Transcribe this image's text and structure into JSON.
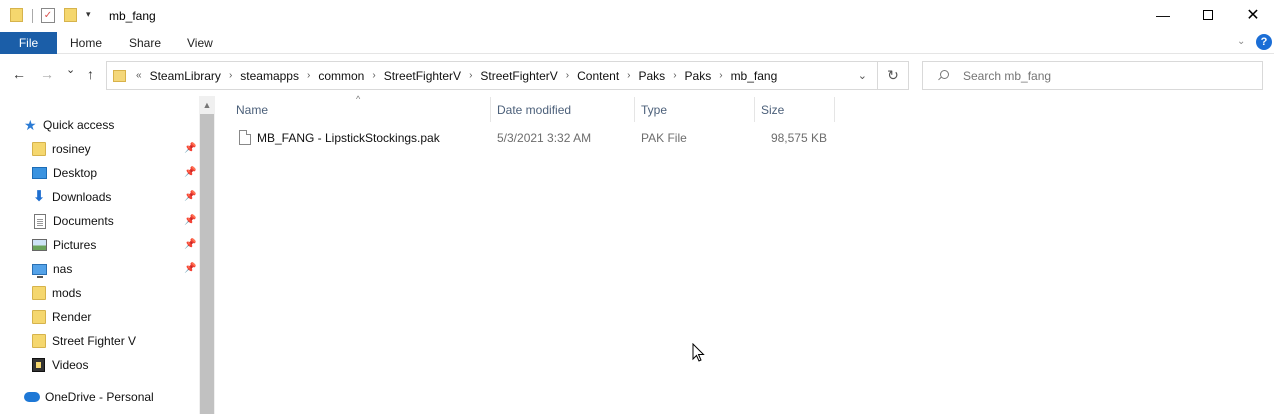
{
  "window": {
    "title": "mb_fang",
    "minimize_icon": "minimize-icon",
    "maximize_icon": "maximize-icon",
    "close_icon": "close-icon"
  },
  "ribbon": {
    "tabs": [
      {
        "label": "File",
        "active": true
      },
      {
        "label": "Home"
      },
      {
        "label": "Share"
      },
      {
        "label": "View"
      }
    ],
    "help_label": "?",
    "accent_color": "#1b5ea8"
  },
  "nav": {
    "back_glyph": "←",
    "forward_glyph": "→",
    "recent_glyph": "⌄",
    "up_glyph": "↑",
    "overflow": "«",
    "breadcrumbs": [
      "SteamLibrary",
      "steamapps",
      "common",
      "StreetFighterV",
      "StreetFighterV",
      "Content",
      "Paks",
      "Paks",
      "mb_fang"
    ],
    "refresh_glyph": "↻",
    "search_placeholder": "Search mb_fang"
  },
  "sidebar": {
    "quick_access": "Quick access",
    "items": [
      {
        "label": "rosiney",
        "icon": "folder-icon",
        "pinned": true
      },
      {
        "label": "Desktop",
        "icon": "desktop-icon",
        "pinned": true
      },
      {
        "label": "Downloads",
        "icon": "downloads-icon",
        "pinned": true
      },
      {
        "label": "Documents",
        "icon": "documents-icon",
        "pinned": true
      },
      {
        "label": "Pictures",
        "icon": "pictures-icon",
        "pinned": true
      },
      {
        "label": "nas",
        "icon": "network-drive-icon",
        "pinned": true
      },
      {
        "label": "mods",
        "icon": "folder-icon",
        "pinned": false
      },
      {
        "label": "Render",
        "icon": "folder-icon",
        "pinned": false
      },
      {
        "label": "Street Fighter V",
        "icon": "folder-icon",
        "pinned": false
      },
      {
        "label": "Videos",
        "icon": "videos-icon",
        "pinned": false
      }
    ],
    "onedrive": "OneDrive - Personal"
  },
  "columns": {
    "name": "Name",
    "date": "Date modified",
    "type": "Type",
    "size": "Size"
  },
  "files": [
    {
      "name": "MB_FANG - LipstickStockings.pak",
      "date": "5/3/2021 3:32 AM",
      "type": "PAK File",
      "size": "98,575 KB"
    }
  ]
}
